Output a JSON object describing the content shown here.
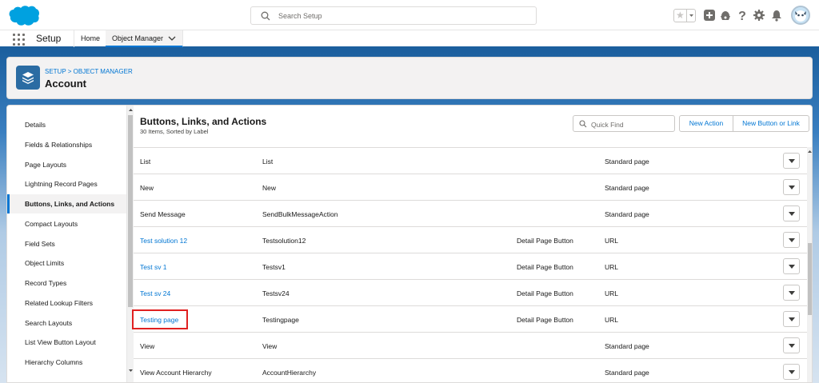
{
  "colors": {
    "brand_blue": "#00a1e0",
    "link": "#0176d3",
    "header_band": "#1b5f9e",
    "highlight": "#e02020"
  },
  "global_header": {
    "search_placeholder": "Search Setup",
    "icons": [
      "cloud-logo",
      "search-icon",
      "favorite-star-icon",
      "add-icon",
      "trailhead-icon",
      "help-icon",
      "gear-icon",
      "bell-icon",
      "avatar"
    ]
  },
  "context_bar": {
    "app_name": "Setup",
    "tabs": [
      {
        "label": "Home",
        "active": false
      },
      {
        "label": "Object Manager",
        "active": true
      }
    ]
  },
  "page_header": {
    "breadcrumb": "SETUP > OBJECT MANAGER",
    "title": "Account",
    "icon": "stack-layers-icon"
  },
  "sidebar": {
    "items": [
      {
        "label": "Details",
        "active": false
      },
      {
        "label": "Fields & Relationships",
        "active": false
      },
      {
        "label": "Page Layouts",
        "active": false
      },
      {
        "label": "Lightning Record Pages",
        "active": false
      },
      {
        "label": "Buttons, Links, and Actions",
        "active": true
      },
      {
        "label": "Compact Layouts",
        "active": false
      },
      {
        "label": "Field Sets",
        "active": false
      },
      {
        "label": "Object Limits",
        "active": false
      },
      {
        "label": "Record Types",
        "active": false
      },
      {
        "label": "Related Lookup Filters",
        "active": false
      },
      {
        "label": "Search Layouts",
        "active": false
      },
      {
        "label": "List View Button Layout",
        "active": false
      },
      {
        "label": "Hierarchy Columns",
        "active": false
      }
    ]
  },
  "content": {
    "title": "Buttons, Links, and Actions",
    "subtitle": "30 Items, Sorted by Label",
    "quick_find_placeholder": "Quick Find",
    "new_action_label": "New Action",
    "new_button_label": "New Button or Link",
    "rows": [
      {
        "label": "List",
        "name": "List",
        "display": "",
        "type": "Standard page",
        "is_link": false,
        "highlighted": false
      },
      {
        "label": "New",
        "name": "New",
        "display": "",
        "type": "Standard page",
        "is_link": false,
        "highlighted": false
      },
      {
        "label": "Send Message",
        "name": "SendBulkMessageAction",
        "display": "",
        "type": "Standard page",
        "is_link": false,
        "highlighted": false
      },
      {
        "label": "Test solution 12",
        "name": "Testsolution12",
        "display": "Detail Page Button",
        "type": "URL",
        "is_link": true,
        "highlighted": false
      },
      {
        "label": "Test sv 1",
        "name": "Testsv1",
        "display": "Detail Page Button",
        "type": "URL",
        "is_link": true,
        "highlighted": false
      },
      {
        "label": "Test sv 24",
        "name": "Testsv24",
        "display": "Detail Page Button",
        "type": "URL",
        "is_link": true,
        "highlighted": false
      },
      {
        "label": "Testing page",
        "name": "Testingpage",
        "display": "Detail Page Button",
        "type": "URL",
        "is_link": true,
        "highlighted": true
      },
      {
        "label": "View",
        "name": "View",
        "display": "",
        "type": "Standard page",
        "is_link": false,
        "highlighted": false
      },
      {
        "label": "View Account Hierarchy",
        "name": "AccountHierarchy",
        "display": "",
        "type": "Standard page",
        "is_link": false,
        "highlighted": false
      }
    ]
  }
}
